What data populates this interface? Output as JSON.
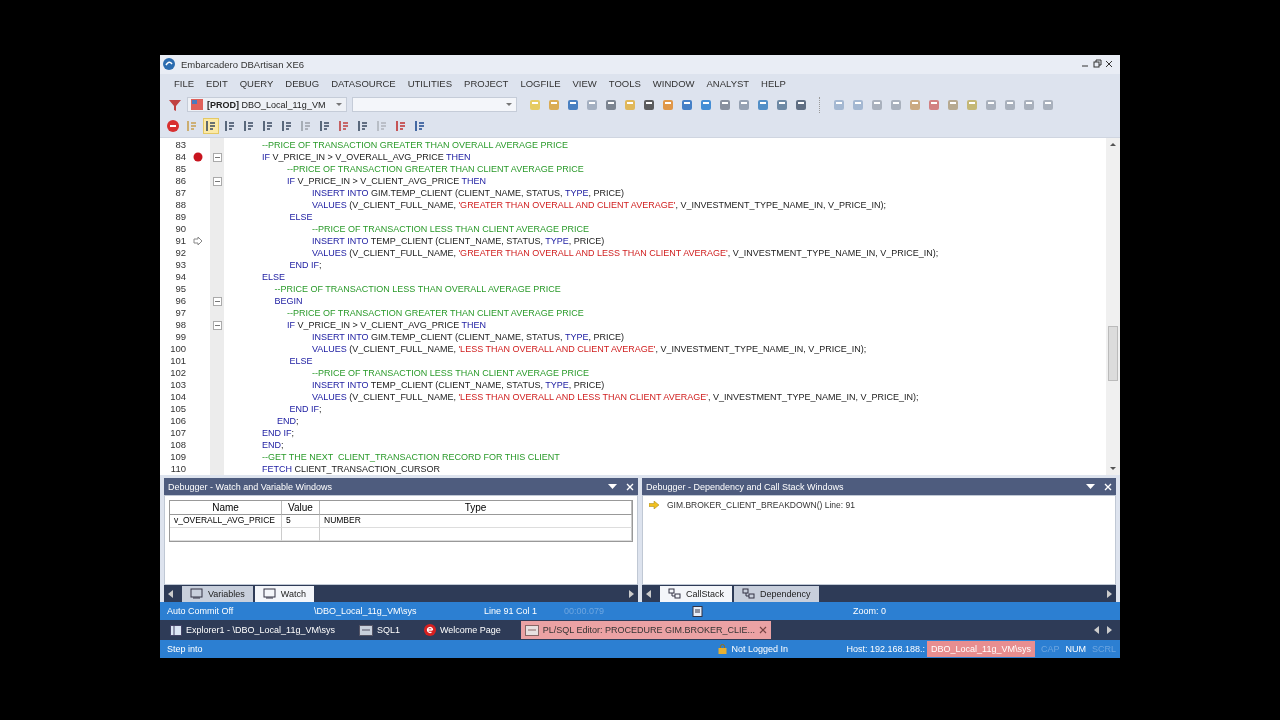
{
  "window": {
    "title": "Embarcadero DBArtisan XE6"
  },
  "menu": [
    "FILE",
    "EDIT",
    "QUERY",
    "DEBUG",
    "DATASOURCE",
    "UTILITIES",
    "PROJECT",
    "LOGFILE",
    "VIEW",
    "TOOLS",
    "WINDOW",
    "ANALYST",
    "HELP"
  ],
  "toolbar": {
    "datasource": "**[PROD]** DBO_Local_11g_VM"
  },
  "editor": {
    "lines": [
      {
        "number": "83",
        "foldable": false,
        "breakpoint": false,
        "current": false,
        "tokens": [
          {
            "kind": "comment",
            "text": "--PRICE OF TRANSACTION GREATER THAN OVERALL AVERAGE PRICE"
          }
        ]
      },
      {
        "number": "84",
        "foldable": true,
        "breakpoint": true,
        "current": false,
        "tokens": [
          {
            "kind": "keyword",
            "text": "IF"
          },
          {
            "kind": "plain",
            "text": " V_PRICE_IN > V_OVERALL_AVG_PRICE "
          },
          {
            "kind": "keyword",
            "text": "THEN"
          }
        ]
      },
      {
        "number": "85",
        "foldable": false,
        "breakpoint": false,
        "current": false,
        "tokens": [
          {
            "kind": "comment",
            "text": "          --PRICE OF TRANSACTION GREATER THAN CLIENT AVERAGE PRICE"
          }
        ]
      },
      {
        "number": "86",
        "foldable": true,
        "breakpoint": false,
        "current": false,
        "tokens": [
          {
            "kind": "keyword",
            "text": "          IF"
          },
          {
            "kind": "plain",
            "text": " V_PRICE_IN > V_CLIENT_AVG_PRICE "
          },
          {
            "kind": "keyword",
            "text": "THEN"
          }
        ]
      },
      {
        "number": "87",
        "foldable": false,
        "breakpoint": false,
        "current": false,
        "tokens": [
          {
            "kind": "keyword",
            "text": "                    INSERT INTO"
          },
          {
            "kind": "plain",
            "text": " GIM.TEMP_CLIENT (CLIENT_NAME, STATUS, "
          },
          {
            "kind": "keyword",
            "text": "TYPE"
          },
          {
            "kind": "plain",
            "text": ", PRICE)"
          }
        ]
      },
      {
        "number": "88",
        "foldable": false,
        "breakpoint": false,
        "current": false,
        "tokens": [
          {
            "kind": "keyword",
            "text": "                    VALUES"
          },
          {
            "kind": "plain",
            "text": " (V_CLIENT_FULL_NAME, "
          },
          {
            "kind": "string",
            "text": "'GREATER THAN OVERALL AND CLIENT AVERAGE'"
          },
          {
            "kind": "plain",
            "text": ", V_INVESTMENT_TYPE_NAME_IN, V_PRICE_IN);"
          }
        ]
      },
      {
        "number": "89",
        "foldable": false,
        "breakpoint": false,
        "current": false,
        "tokens": [
          {
            "kind": "keyword",
            "text": "           ELSE"
          }
        ]
      },
      {
        "number": "90",
        "foldable": false,
        "breakpoint": false,
        "current": false,
        "tokens": [
          {
            "kind": "comment",
            "text": "                    --PRICE OF TRANSACTION LESS THAN CLIENT AVERAGE PRICE"
          }
        ]
      },
      {
        "number": "91",
        "foldable": false,
        "breakpoint": false,
        "current": true,
        "tokens": [
          {
            "kind": "keyword",
            "text": "                    INSERT INTO"
          },
          {
            "kind": "plain",
            "text": " TEMP_CLIENT (CLIENT_NAME, STATUS, "
          },
          {
            "kind": "keyword",
            "text": "TYPE"
          },
          {
            "kind": "plain",
            "text": ", PRICE)"
          }
        ]
      },
      {
        "number": "92",
        "foldable": false,
        "breakpoint": false,
        "current": false,
        "tokens": [
          {
            "kind": "keyword",
            "text": "                    VALUES"
          },
          {
            "kind": "plain",
            "text": " (V_CLIENT_FULL_NAME, "
          },
          {
            "kind": "string",
            "text": "'GREATER THAN OVERALL AND LESS THAN CLIENT AVERAGE'"
          },
          {
            "kind": "plain",
            "text": ", V_INVESTMENT_TYPE_NAME_IN, V_PRICE_IN);"
          }
        ]
      },
      {
        "number": "93",
        "foldable": false,
        "breakpoint": false,
        "current": false,
        "tokens": [
          {
            "kind": "keyword",
            "text": "           END IF"
          },
          {
            "kind": "plain",
            "text": ";"
          }
        ]
      },
      {
        "number": "94",
        "foldable": false,
        "breakpoint": false,
        "current": false,
        "tokens": [
          {
            "kind": "keyword",
            "text": "ELSE"
          }
        ]
      },
      {
        "number": "95",
        "foldable": false,
        "breakpoint": false,
        "current": false,
        "tokens": [
          {
            "kind": "comment",
            "text": "     --PRICE OF TRANSACTION LESS THAN OVERALL AVERAGE PRICE"
          }
        ]
      },
      {
        "number": "96",
        "foldable": true,
        "breakpoint": false,
        "current": false,
        "tokens": [
          {
            "kind": "keyword",
            "text": "     BEGIN"
          }
        ]
      },
      {
        "number": "97",
        "foldable": false,
        "breakpoint": false,
        "current": false,
        "tokens": [
          {
            "kind": "comment",
            "text": "          --PRICE OF TRANSACTION GREATER THAN CLIENT AVERAGE PRICE"
          }
        ]
      },
      {
        "number": "98",
        "foldable": true,
        "breakpoint": false,
        "current": false,
        "tokens": [
          {
            "kind": "keyword",
            "text": "          IF"
          },
          {
            "kind": "plain",
            "text": " V_PRICE_IN > V_CLIENT_AVG_PRICE "
          },
          {
            "kind": "keyword",
            "text": "THEN"
          }
        ]
      },
      {
        "number": "99",
        "foldable": false,
        "breakpoint": false,
        "current": false,
        "tokens": [
          {
            "kind": "keyword",
            "text": "                    INSERT INTO"
          },
          {
            "kind": "plain",
            "text": " GIM.TEMP_CLIENT (CLIENT_NAME, STATUS, "
          },
          {
            "kind": "keyword",
            "text": "TYPE"
          },
          {
            "kind": "plain",
            "text": ", PRICE)"
          }
        ]
      },
      {
        "number": "100",
        "foldable": false,
        "breakpoint": false,
        "current": false,
        "tokens": [
          {
            "kind": "keyword",
            "text": "                    VALUES"
          },
          {
            "kind": "plain",
            "text": " (V_CLIENT_FULL_NAME, "
          },
          {
            "kind": "string",
            "text": "'LESS THAN OVERALL AND CLIENT AVERAGE'"
          },
          {
            "kind": "plain",
            "text": ", V_INVESTMENT_TYPE_NAME_IN, V_PRICE_IN);"
          }
        ]
      },
      {
        "number": "101",
        "foldable": false,
        "breakpoint": false,
        "current": false,
        "tokens": [
          {
            "kind": "keyword",
            "text": "           ELSE"
          }
        ]
      },
      {
        "number": "102",
        "foldable": false,
        "breakpoint": false,
        "current": false,
        "tokens": [
          {
            "kind": "comment",
            "text": "                    --PRICE OF TRANSACTION LESS THAN CLIENT AVERAGE PRICE"
          }
        ]
      },
      {
        "number": "103",
        "foldable": false,
        "breakpoint": false,
        "current": false,
        "tokens": [
          {
            "kind": "keyword",
            "text": "                    INSERT INTO"
          },
          {
            "kind": "plain",
            "text": " TEMP_CLIENT (CLIENT_NAME, STATUS, "
          },
          {
            "kind": "keyword",
            "text": "TYPE"
          },
          {
            "kind": "plain",
            "text": ", PRICE)"
          }
        ]
      },
      {
        "number": "104",
        "foldable": false,
        "breakpoint": false,
        "current": false,
        "tokens": [
          {
            "kind": "keyword",
            "text": "                    VALUES"
          },
          {
            "kind": "plain",
            "text": " (V_CLIENT_FULL_NAME, "
          },
          {
            "kind": "string",
            "text": "'LESS THAN OVERALL AND LESS THAN CLIENT AVERAGE'"
          },
          {
            "kind": "plain",
            "text": ", V_INVESTMENT_TYPE_NAME_IN, V_PRICE_IN);"
          }
        ]
      },
      {
        "number": "105",
        "foldable": false,
        "breakpoint": false,
        "current": false,
        "tokens": [
          {
            "kind": "keyword",
            "text": "           END IF"
          },
          {
            "kind": "plain",
            "text": ";"
          }
        ]
      },
      {
        "number": "106",
        "foldable": false,
        "breakpoint": false,
        "current": false,
        "tokens": [
          {
            "kind": "keyword",
            "text": "      END"
          },
          {
            "kind": "plain",
            "text": ";"
          }
        ]
      },
      {
        "number": "107",
        "foldable": false,
        "breakpoint": false,
        "current": false,
        "tokens": [
          {
            "kind": "keyword",
            "text": "END IF"
          },
          {
            "kind": "plain",
            "text": ";"
          }
        ]
      },
      {
        "number": "108",
        "foldable": false,
        "breakpoint": false,
        "current": false,
        "tokens": [
          {
            "kind": "keyword",
            "text": "END"
          },
          {
            "kind": "plain",
            "text": ";"
          }
        ]
      },
      {
        "number": "109",
        "foldable": false,
        "breakpoint": false,
        "current": false,
        "tokens": [
          {
            "kind": "comment",
            "text": "--GET THE NEXT  CLIENT_TRANSACTION RECORD FOR THIS CLIENT"
          }
        ]
      },
      {
        "number": "110",
        "foldable": false,
        "breakpoint": false,
        "current": false,
        "tokens": [
          {
            "kind": "keyword",
            "text": "FETCH"
          },
          {
            "kind": "plain",
            "text": " CLIENT_TRANSACTION_CURSOR"
          }
        ]
      }
    ]
  },
  "watch_panel": {
    "title": "Debugger  - Watch and Variable Windows",
    "columns": [
      "Name",
      "Value",
      "Type"
    ],
    "rows": [
      [
        "v_OVERALL_AVG_PRICE",
        "5",
        "NUMBER"
      ]
    ],
    "tabs": [
      {
        "label": "Variables",
        "selected": false
      },
      {
        "label": "Watch",
        "selected": true
      }
    ]
  },
  "callstack_panel": {
    "title": "Debugger - Dependency and Call Stack Windows",
    "entries": [
      "GIM.BROKER_CLIENT_BREAKDOWN() Line: 91"
    ],
    "tabs": [
      {
        "label": "CallStack",
        "selected": true
      },
      {
        "label": "Dependency",
        "selected": false
      }
    ]
  },
  "status_bar": [
    {
      "text": "Auto Commit Off",
      "disabled": false
    },
    {
      "text": "\\DBO_Local_11g_VM\\sys",
      "disabled": false
    },
    {
      "text": "Line 91 Col 1",
      "disabled": false
    },
    {
      "text": "00:00.079",
      "disabled": true
    },
    {
      "text": "Zoom:  0",
      "disabled": false
    }
  ],
  "document_tabs": [
    {
      "kind": "explorer",
      "label": "Explorer1 - \\DBO_Local_11g_VM\\sys",
      "selected": false
    },
    {
      "kind": "sql",
      "label": "SQL1",
      "selected": false
    },
    {
      "kind": "welcome",
      "label": "Welcome Page",
      "selected": false
    },
    {
      "kind": "plsql",
      "label": "PL/SQL Editor: PROCEDURE GIM.BROKER_CLIE...",
      "selected": true
    }
  ],
  "bottom_bar": {
    "message": "Step into",
    "login": "Not Logged In",
    "host": "Host: 192.168.188.:",
    "connection": "DBO_Local_11g_VM\\sys",
    "indicators": [
      {
        "text": "CAP",
        "on": false
      },
      {
        "text": "NUM",
        "on": true
      },
      {
        "text": "SCRL",
        "on": false
      }
    ]
  }
}
